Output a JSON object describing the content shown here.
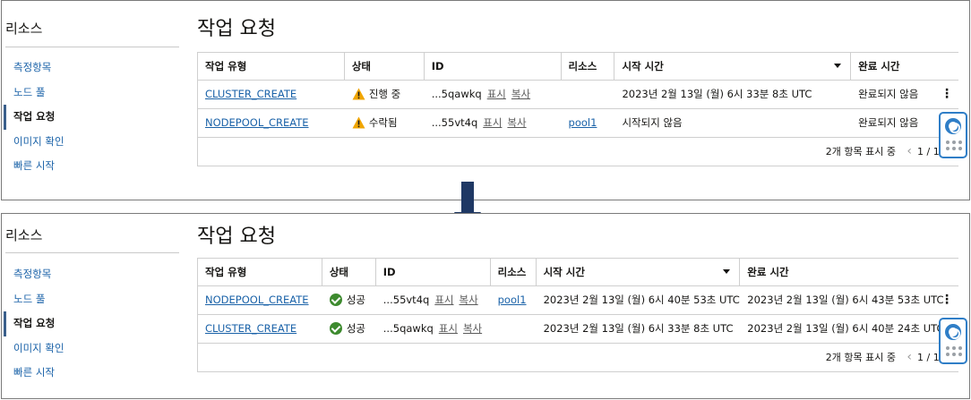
{
  "sidebar": {
    "title": "리소스",
    "items": [
      {
        "label": "측정항목"
      },
      {
        "label": "노드 풀"
      },
      {
        "label": "작업 요청"
      },
      {
        "label": "이미지 확인"
      },
      {
        "label": "빠른 시작"
      }
    ],
    "active_index": 2
  },
  "page_title": "작업 요청",
  "table_headers": [
    "작업 유형",
    "상태",
    "ID",
    "리소스",
    "시작 시간",
    "완료 시간"
  ],
  "before": {
    "rows": [
      {
        "type": "CLUSTER_CREATE",
        "status": "진행 중",
        "status_icon": "warning-icon",
        "id": "...5qawkq",
        "show": "표시",
        "copy": "복사",
        "resource": "",
        "start": "2023년 2월 13일 (월) 6시 33분 8초 UTC",
        "end": "완료되지 않음"
      },
      {
        "type": "NODEPOOL_CREATE",
        "status": "수락됨",
        "status_icon": "warning-icon",
        "id": "...55vt4q",
        "show": "표시",
        "copy": "복사",
        "resource": "pool1",
        "start": "시작되지 않음",
        "end": "완료되지 않음"
      }
    ],
    "footer": {
      "count_text": "2개 항목 표시 중",
      "page_text": "1 / 1"
    }
  },
  "after": {
    "rows": [
      {
        "type": "NODEPOOL_CREATE",
        "status": "성공",
        "status_icon": "check-circle-icon",
        "id": "...55vt4q",
        "show": "표시",
        "copy": "복사",
        "resource": "pool1",
        "start": "2023년 2월 13일 (월) 6시 40분 53초 UTC",
        "end": "2023년 2월 13일 (월) 6시 43분 53초 UTC"
      },
      {
        "type": "CLUSTER_CREATE",
        "status": "성공",
        "status_icon": "check-circle-icon",
        "id": "...5qawkq",
        "show": "표시",
        "copy": "복사",
        "resource": "",
        "start": "2023년 2월 13일 (월) 6시 33분 8초 UTC",
        "end": "2023년 2월 13일 (월) 6시 40분 24초 UTC"
      }
    ],
    "footer": {
      "count_text": "2개 항목 표시 중",
      "page_text": "1 / 1"
    }
  },
  "colors": {
    "link": "#1a62a8",
    "success": "#3d8a2e",
    "warning": "#f0a500",
    "arrow": "#1f3864",
    "help_widget": "#2f7ec7"
  }
}
